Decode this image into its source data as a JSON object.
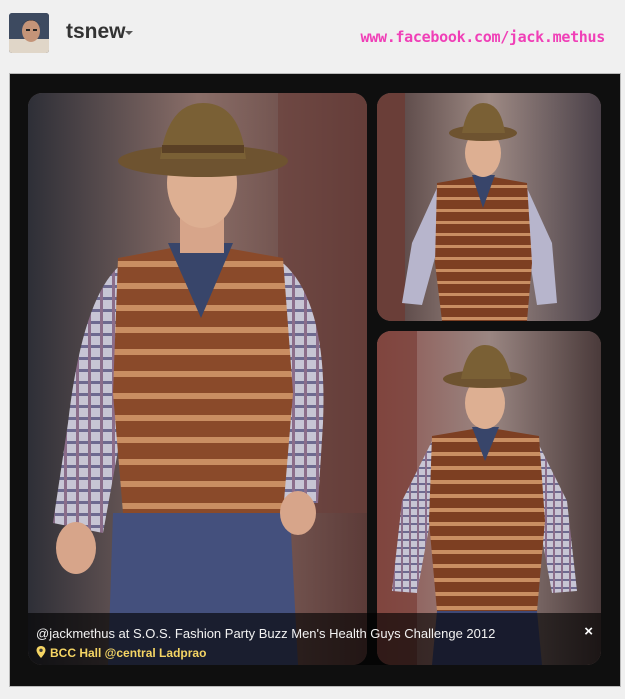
{
  "header": {
    "username": "tsnew",
    "watermark": "www.facebook.com/jack.methus"
  },
  "caption": {
    "text": "@jackmethus at S.O.S. Fashion Party Buzz Men's Health Guys Challenge 2012",
    "location": "BCC Hall @central Ladprao",
    "close_symbol": "×"
  },
  "colors": {
    "watermark": "#f03fb7",
    "location": "#f5d564"
  }
}
